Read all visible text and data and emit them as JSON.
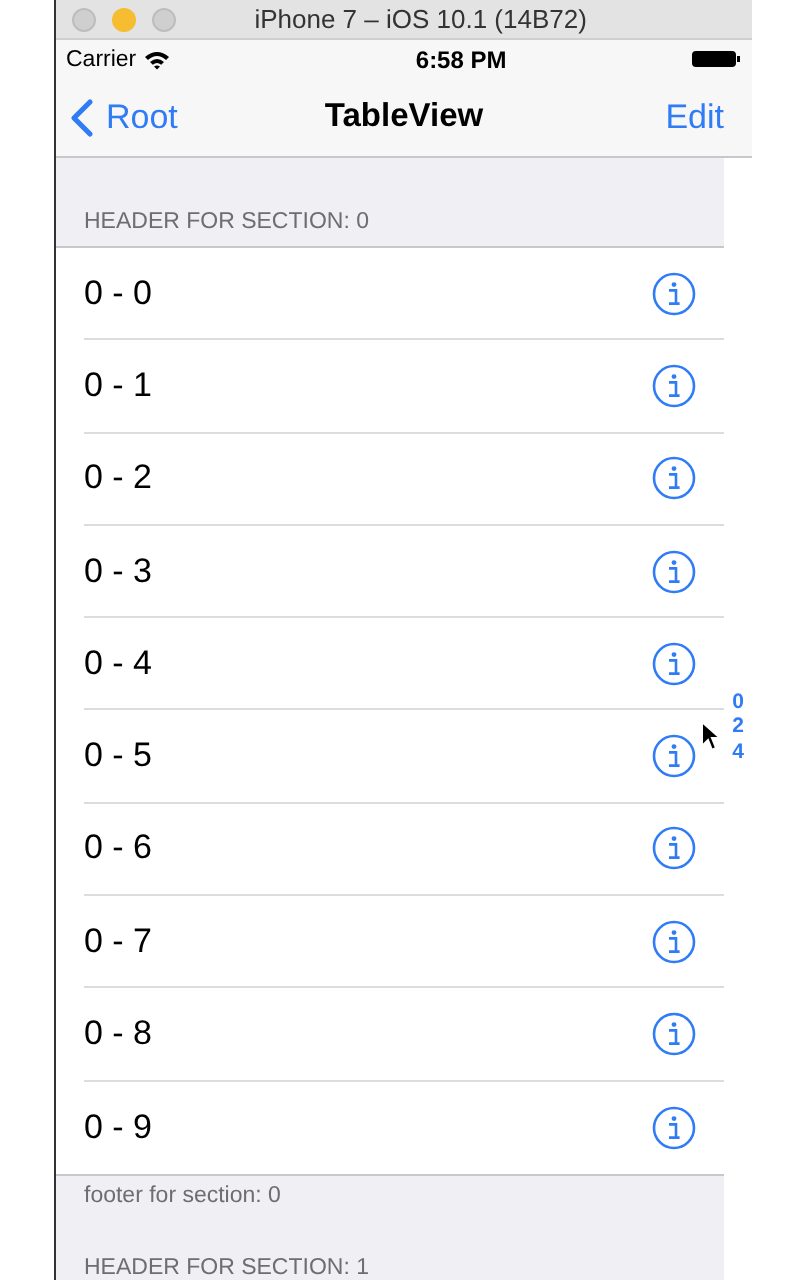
{
  "window": {
    "title": "iPhone 7 – iOS 10.1 (14B72)"
  },
  "status_bar": {
    "carrier": "Carrier",
    "time": "6:58 PM"
  },
  "nav_bar": {
    "back": "Root",
    "title": "TableView",
    "action": "Edit"
  },
  "sections": [
    {
      "header": "HEADER FOR SECTION: 0",
      "footer": "footer for section: 0",
      "rows": [
        {
          "label": "0 - 0"
        },
        {
          "label": "0 - 1"
        },
        {
          "label": "0 - 2"
        },
        {
          "label": "0 - 3"
        },
        {
          "label": "0 - 4"
        },
        {
          "label": "0 - 5"
        },
        {
          "label": "0 - 6"
        },
        {
          "label": "0 - 7"
        },
        {
          "label": "0 - 8"
        },
        {
          "label": "0 - 9"
        }
      ]
    },
    {
      "header": "HEADER FOR SECTION: 1"
    }
  ],
  "section_index": [
    "0",
    "2",
    "4"
  ]
}
